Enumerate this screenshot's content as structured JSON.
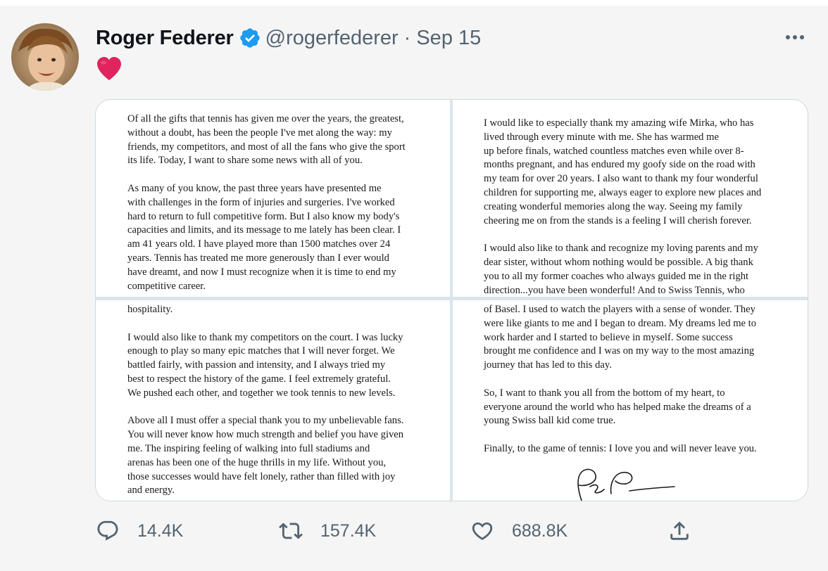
{
  "tweet": {
    "author_name": "Roger Federer",
    "handle": "@rogerfederer",
    "separator": "·",
    "date": "Sep 15",
    "body_emoji": "heart-emoji",
    "accent_color": "#1d9bf0",
    "heart_color": "#e0245e"
  },
  "letter": {
    "quadrant1": [
      [
        "Of all the gifts that tennis has given me over the years, the greatest,",
        "without a doubt, has been the people I've met along the way: my",
        "friends, my competitors, and most of all the fans who give the sport",
        "its life. Today, I want to share some news with all of you."
      ],
      [
        "As many of you know, the past three years have presented me",
        "with challenges in the form of injuries and surgeries. I've worked",
        "hard to return to full competitive form. But I also know my body's",
        "capacities and limits, and its message to me lately has been clear. I",
        "am 41 years old. I have played more than 1500 matches over 24",
        "years. Tennis has treated me more generously than I ever would",
        "have dreamt, and now I must recognize when it is time to end my",
        "competitive career."
      ]
    ],
    "quadrant2": [
      [
        "I would like to especially thank my amazing wife Mirka, who has",
        "lived through every minute with me. She has warmed me",
        "up before finals, watched countless matches even while over 8-",
        "months pregnant, and has endured my goofy side on the road with",
        "my team for over 20 years. I also want to thank my four wonderful",
        "children for supporting me, always eager to explore new places and",
        "creating wonderful memories along the way. Seeing my family",
        "cheering me on from the stands is a feeling I will cherish forever."
      ],
      [
        "I would also like to thank and recognize my loving parents and my",
        "dear sister, without whom nothing would be possible. A big thank",
        "you to all my former coaches who always guided me in the right",
        "direction...you have been wonderful! And to Swiss Tennis, who"
      ]
    ],
    "quadrant3": [
      [
        "hospitality."
      ],
      [
        "I would also like to thank my competitors on the court. I was lucky",
        "enough to play so many epic matches that I will never forget. We",
        "battled fairly, with passion and intensity, and I always tried my",
        "best to respect the history of the game. I feel extremely grateful.",
        "We pushed each other, and together we took tennis to new levels."
      ],
      [
        "Above all I must offer a special thank you to my unbelievable fans.",
        "You will never know how much strength and belief you have given",
        "me. The inspiring feeling of walking into full stadiums and",
        "arenas has been one of the huge thrills in my life. Without you,",
        "those successes would have felt lonely, rather than filled with joy",
        "and energy."
      ]
    ],
    "quadrant4": [
      [
        "of Basel. I used to watch the players with a sense of wonder. They",
        "were like giants to me and I began to dream. My dreams led me to",
        "work harder and I started to believe in myself. Some success",
        "brought me confidence and I was on my way to the most amazing",
        "journey that has led to this day."
      ],
      [
        "So, I want to thank you all from the bottom of my heart, to",
        "everyone around the world who has helped make the dreams of a",
        "young Swiss ball kid come true."
      ],
      [
        "Finally, to the game of tennis: I love you and will never leave you."
      ]
    ]
  },
  "actions": {
    "reply_count": "14.4K",
    "retweet_count": "157.4K",
    "like_count": "688.8K"
  },
  "icons": {
    "reply": "reply-icon",
    "retweet": "retweet-icon",
    "like": "like-icon",
    "share": "share-icon",
    "more": "more-icon",
    "verified": "verified-badge-icon"
  }
}
